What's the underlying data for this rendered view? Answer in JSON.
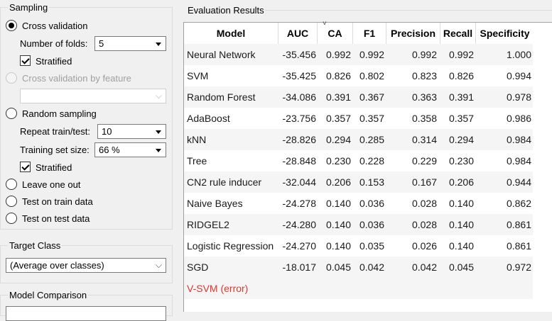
{
  "sampling": {
    "title": "Sampling",
    "cross_validation": "Cross validation",
    "folds_label": "Number of folds:",
    "folds_value": "5",
    "stratified_1": "Stratified",
    "cv_by_feature": "Cross validation by feature",
    "feature_value": "",
    "random_sampling": "Random sampling",
    "repeat_label": "Repeat train/test:",
    "repeat_value": "10",
    "train_size_label": "Training set size:",
    "train_size_value": "66 %",
    "stratified_2": "Stratified",
    "leave_one_out": "Leave one out",
    "test_on_train": "Test on train data",
    "test_on_test": "Test on test data"
  },
  "target": {
    "title": "Target Class",
    "value": "(Average over classes)"
  },
  "comparison": {
    "title": "Model Comparison"
  },
  "results": {
    "title": "Evaluation Results",
    "headers": [
      "Model",
      "AUC",
      "CA",
      "F1",
      "Precision",
      "Recall",
      "Specificity"
    ],
    "sort_indicator": "˅",
    "rows": [
      {
        "model": "Neural Network",
        "auc": "-35.456",
        "ca": "0.992",
        "f1": "0.992",
        "precision": "0.992",
        "recall": "0.992",
        "specificity": "1.000"
      },
      {
        "model": "SVM",
        "auc": "-35.425",
        "ca": "0.826",
        "f1": "0.802",
        "precision": "0.823",
        "recall": "0.826",
        "specificity": "0.994"
      },
      {
        "model": "Random Forest",
        "auc": "-34.086",
        "ca": "0.391",
        "f1": "0.367",
        "precision": "0.363",
        "recall": "0.391",
        "specificity": "0.978"
      },
      {
        "model": "AdaBoost",
        "auc": "-23.756",
        "ca": "0.357",
        "f1": "0.357",
        "precision": "0.358",
        "recall": "0.357",
        "specificity": "0.986"
      },
      {
        "model": "kNN",
        "auc": "-28.826",
        "ca": "0.294",
        "f1": "0.285",
        "precision": "0.314",
        "recall": "0.294",
        "specificity": "0.984"
      },
      {
        "model": "Tree",
        "auc": "-28.848",
        "ca": "0.230",
        "f1": "0.228",
        "precision": "0.229",
        "recall": "0.230",
        "specificity": "0.984"
      },
      {
        "model": "CN2 rule inducer",
        "auc": "-32.044",
        "ca": "0.206",
        "f1": "0.153",
        "precision": "0.167",
        "recall": "0.206",
        "specificity": "0.944"
      },
      {
        "model": "Naive Bayes",
        "auc": "-24.278",
        "ca": "0.140",
        "f1": "0.036",
        "precision": "0.028",
        "recall": "0.140",
        "specificity": "0.862"
      },
      {
        "model": "RIDGEL2",
        "auc": "-24.280",
        "ca": "0.140",
        "f1": "0.036",
        "precision": "0.028",
        "recall": "0.140",
        "specificity": "0.861"
      },
      {
        "model": "Logistic Regression",
        "auc": "-24.270",
        "ca": "0.140",
        "f1": "0.035",
        "precision": "0.026",
        "recall": "0.140",
        "specificity": "0.861"
      },
      {
        "model": "SGD",
        "auc": "-18.017",
        "ca": "0.045",
        "f1": "0.042",
        "precision": "0.042",
        "recall": "0.045",
        "specificity": "0.972"
      }
    ],
    "error_row": "V-SVM (error)",
    "error_color": "#e3342f"
  }
}
